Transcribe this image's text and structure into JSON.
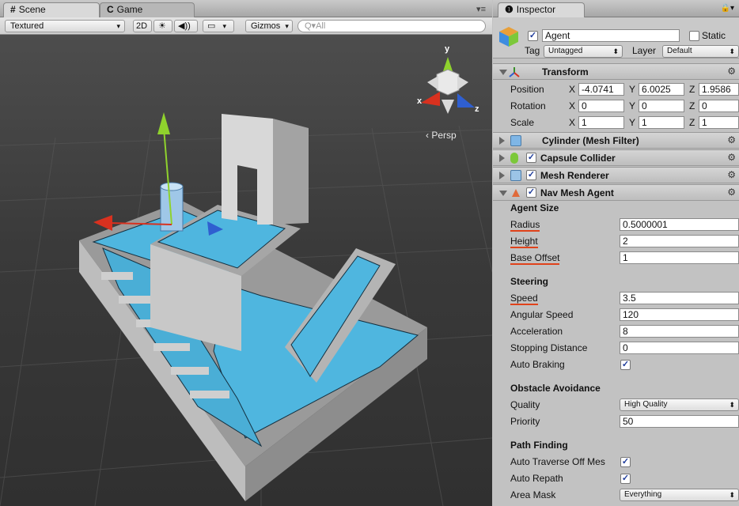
{
  "scene_panel": {
    "tabs": [
      {
        "label": "Scene",
        "icon": "#"
      },
      {
        "label": "Game",
        "icon": "C"
      }
    ],
    "menu_icon": "▾≡",
    "toolbar": {
      "draw_mode": "Textured",
      "mode_2d": "2D",
      "lighting_icon": "☀",
      "audio_icon": "◀))",
      "effects_icon": "▭",
      "gizmos": "Gizmos",
      "search_placeholder": "Q▾All"
    },
    "viewport": {
      "persp_label": "‹ Persp",
      "axis_labels": {
        "y": "y",
        "x": "x",
        "z": "z"
      }
    }
  },
  "inspector": {
    "tab_label": "Inspector",
    "lock_icon": "🔒▾",
    "object": {
      "name": "Agent",
      "active": true,
      "static_label": "Static",
      "tag_label": "Tag",
      "tag_value": "Untagged",
      "layer_label": "Layer",
      "layer_value": "Default"
    },
    "transform": {
      "title": "Transform",
      "rows": [
        {
          "label": "Position",
          "x": "-4.0741",
          "y": "6.0025",
          "z": "1.9586"
        },
        {
          "label": "Rotation",
          "x": "0",
          "y": "0",
          "z": "0"
        },
        {
          "label": "Scale",
          "x": "1",
          "y": "1",
          "z": "1"
        }
      ],
      "axis": {
        "x": "X",
        "y": "Y",
        "z": "Z"
      }
    },
    "components": [
      {
        "name": "Cylinder (Mesh Filter)",
        "checkbox": false
      },
      {
        "name": "Capsule Collider",
        "checkbox": true
      },
      {
        "name": "Mesh Renderer",
        "checkbox": true
      }
    ],
    "nav_mesh_agent": {
      "title": "Nav Mesh Agent",
      "agent_size_header": "Agent Size",
      "radius_label": "Radius",
      "radius": "0.5000001",
      "height_label": "Height",
      "height": "2",
      "base_offset_label": "Base Offset",
      "base_offset": "1",
      "steering_header": "Steering",
      "speed_label": "Speed",
      "speed": "3.5",
      "angular_speed_label": "Angular Speed",
      "angular_speed": "120",
      "acceleration_label": "Acceleration",
      "acceleration": "8",
      "stopping_distance_label": "Stopping Distance",
      "stopping_distance": "0",
      "auto_braking_label": "Auto Braking",
      "auto_braking": true,
      "obstacle_header": "Obstacle Avoidance",
      "quality_label": "Quality",
      "quality": "High Quality",
      "priority_label": "Priority",
      "priority": "50",
      "path_header": "Path Finding",
      "auto_traverse_label": "Auto Traverse Off Mes",
      "auto_traverse": true,
      "auto_repath_label": "Auto Repath",
      "auto_repath": true,
      "area_mask_label": "Area Mask",
      "area_mask": "Everything"
    }
  },
  "colors": {
    "accent_underline": "#e0421a",
    "navmesh": "#4fb6df",
    "gizmo_y": "#8fd22d",
    "gizmo_x": "#d8311f",
    "gizmo_z": "#2f5fd0"
  }
}
